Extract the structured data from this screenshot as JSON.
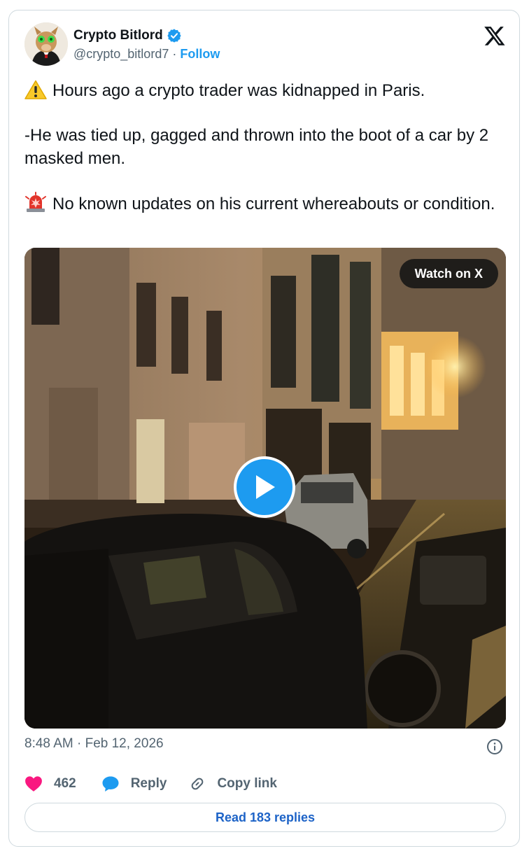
{
  "author": {
    "display_name": "Crypto Bitlord",
    "handle": "@crypto_bitlord7",
    "separator": "·",
    "follow_label": "Follow"
  },
  "tweet": {
    "paragraphs": [
      "Hours ago a crypto trader was kidnapped in Paris.",
      "-He was tied up, gagged and thrown into the boot of a car by 2 masked men.",
      "No known updates on his current whereabouts or condition."
    ],
    "paragraph_icons": [
      "warning-emoji",
      "none",
      "siren-emoji"
    ]
  },
  "media": {
    "watch_label": "Watch on X"
  },
  "timestamp": "8:48 AM · Feb 12, 2026",
  "actions": {
    "like_count": "462",
    "reply_label": "Reply",
    "copy_link_label": "Copy link"
  },
  "read_replies_label": "Read 183 replies",
  "colors": {
    "accent": "#1d9bf0",
    "like": "#f91880",
    "text": "#0f1419",
    "muted": "#536471",
    "border": "#cfd9de"
  }
}
